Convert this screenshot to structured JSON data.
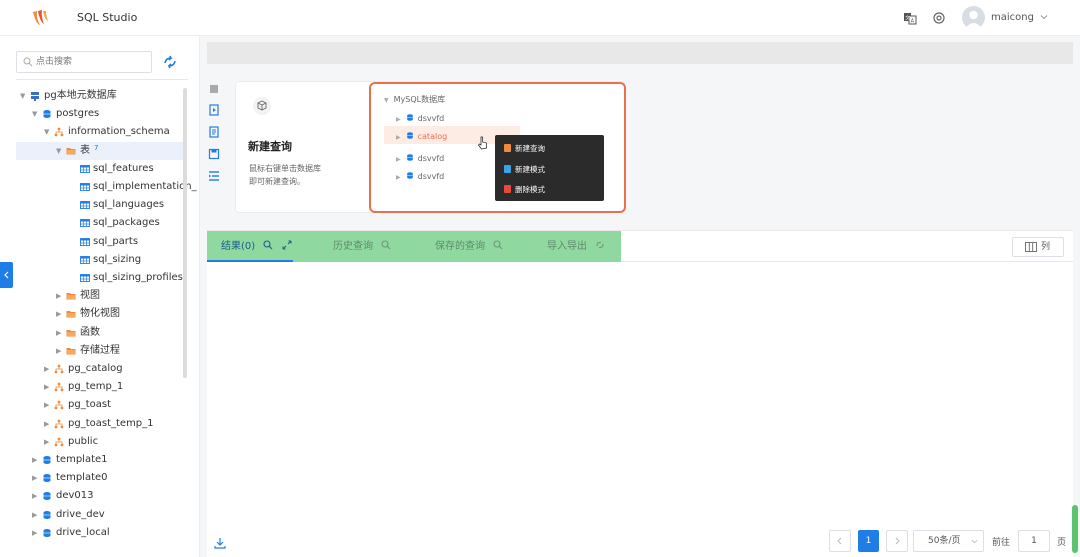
{
  "header": {
    "app_title": "SQL Studio",
    "username": "maicong",
    "icons": [
      "translate-icon",
      "settings-icon",
      "avatar",
      "chevron-down-icon"
    ]
  },
  "sidebar": {
    "search_placeholder": "点击搜索",
    "tree": [
      {
        "label": "pg本地元数据库",
        "icon": "server-icon",
        "expanded": true,
        "depth": 0
      },
      {
        "label": "postgres",
        "icon": "database-icon",
        "expanded": true,
        "depth": 1
      },
      {
        "label": "information_schema",
        "icon": "schema-icon",
        "expanded": true,
        "depth": 2
      },
      {
        "label": "表",
        "badge": "7",
        "icon": "folder-icon",
        "expanded": true,
        "depth": 3,
        "selected": true
      },
      {
        "label": "sql_features",
        "icon": "table-icon",
        "depth": 4
      },
      {
        "label": "sql_implementation_",
        "icon": "table-icon",
        "depth": 4
      },
      {
        "label": "sql_languages",
        "icon": "table-icon",
        "depth": 4
      },
      {
        "label": "sql_packages",
        "icon": "table-icon",
        "depth": 4
      },
      {
        "label": "sql_parts",
        "icon": "table-icon",
        "depth": 4
      },
      {
        "label": "sql_sizing",
        "icon": "table-icon",
        "depth": 4
      },
      {
        "label": "sql_sizing_profiles",
        "icon": "table-icon",
        "depth": 4
      },
      {
        "label": "视图",
        "icon": "folder-icon",
        "depth": 3
      },
      {
        "label": "物化视图",
        "icon": "folder-icon",
        "depth": 3
      },
      {
        "label": "函数",
        "icon": "folder-icon",
        "depth": 3
      },
      {
        "label": "存储过程",
        "icon": "folder-icon",
        "depth": 3
      },
      {
        "label": "pg_catalog",
        "icon": "schema-icon",
        "depth": 2
      },
      {
        "label": "pg_temp_1",
        "icon": "schema-icon",
        "depth": 2
      },
      {
        "label": "pg_toast",
        "icon": "schema-icon",
        "depth": 2
      },
      {
        "label": "pg_toast_temp_1",
        "icon": "schema-icon",
        "depth": 2
      },
      {
        "label": "public",
        "icon": "schema-icon",
        "depth": 2
      },
      {
        "label": "template1",
        "icon": "database-icon",
        "depth": 1
      },
      {
        "label": "template0",
        "icon": "database-icon",
        "depth": 1
      },
      {
        "label": "dev013",
        "icon": "database-icon",
        "depth": 1
      },
      {
        "label": "drive_dev",
        "icon": "database-icon",
        "depth": 1
      },
      {
        "label": "drive_local",
        "icon": "database-icon",
        "depth": 1
      }
    ]
  },
  "card": {
    "title": "新建查询",
    "desc_line1": "鼠标右键单击数据库",
    "desc_line2": "即可新建查询。",
    "demo": {
      "root": "MySQL数据库",
      "items": [
        "dsvvfd",
        "catalog",
        "dsvvfd",
        "dsvvfd"
      ],
      "menu": [
        "新建查询",
        "新建模式",
        "删除模式"
      ]
    }
  },
  "tabs": [
    {
      "label": "结果(0)",
      "active": true
    },
    {
      "label": "历史查询"
    },
    {
      "label": "保存的查询"
    },
    {
      "label": "导入导出"
    }
  ],
  "columns_label": "列",
  "pagination": {
    "current_page": "1",
    "page_size": "50条/页",
    "goto_label": "前往",
    "goto_value": "1",
    "page_unit": "页"
  },
  "colors": {
    "accent": "#1f7de8",
    "highlight": "#e8704f",
    "tab_strip": "#8fd9a0"
  }
}
